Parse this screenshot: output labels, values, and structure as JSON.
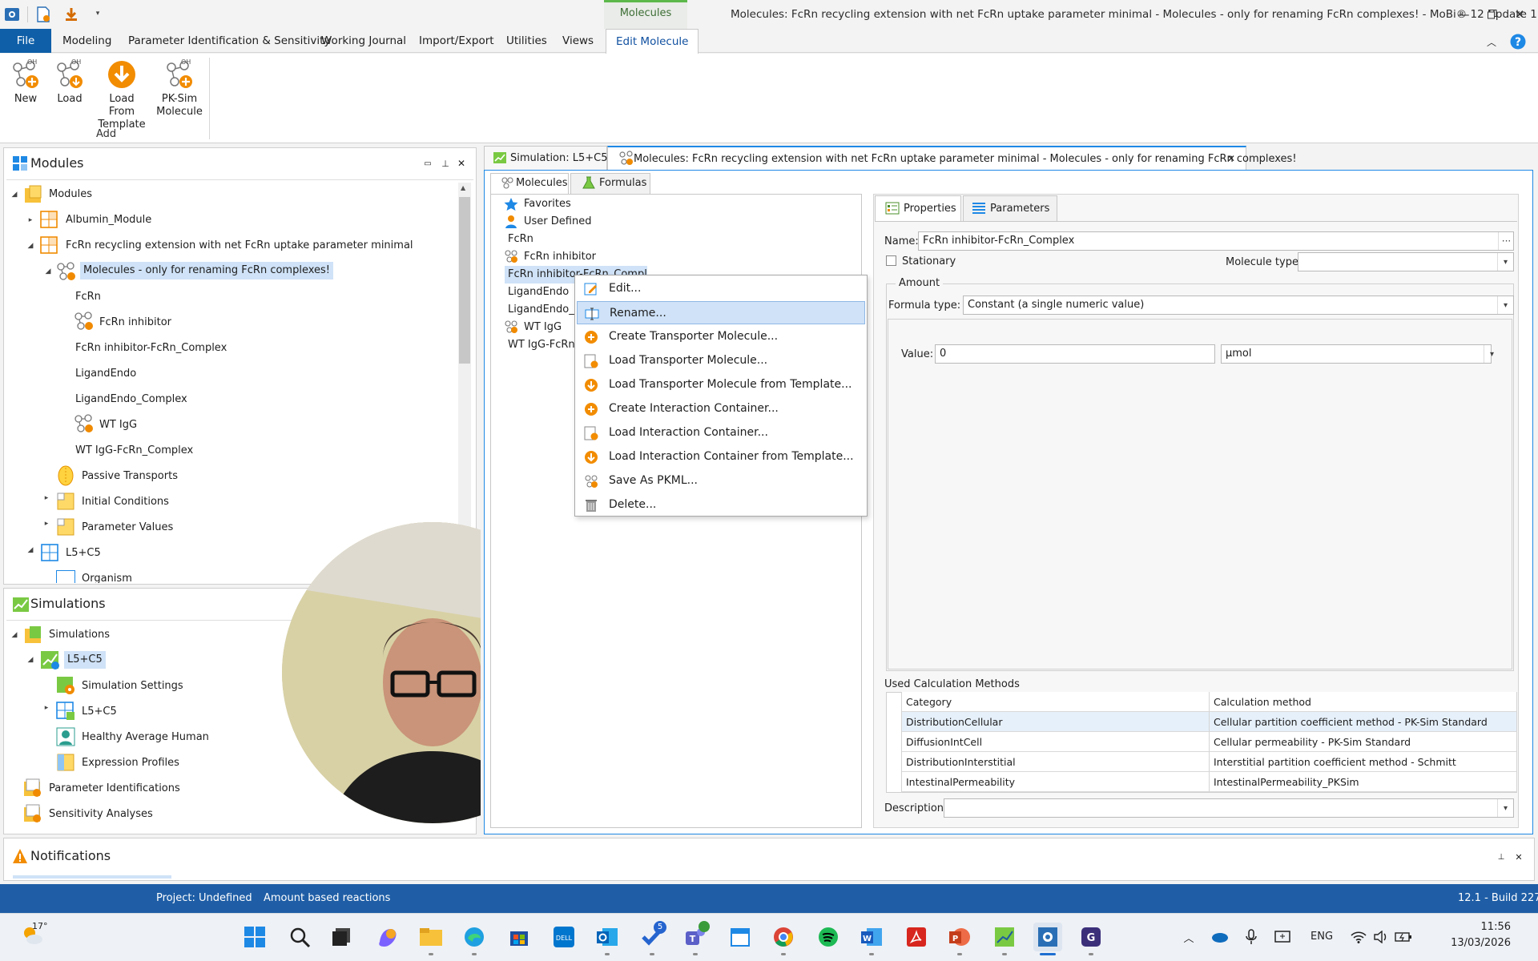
{
  "window": {
    "title": "Molecules: FcRn recycling extension with net FcRn uptake parameter minimal - Molecules - only for renaming FcRn complexes! - MoBi® 12 Update 1",
    "context_tab": "Molecules"
  },
  "menu": {
    "file": "File",
    "modeling": "Modeling",
    "param_ident": "Parameter Identification & Sensitivity",
    "journal": "Working Journal",
    "import_export": "Import/Export",
    "utilities": "Utilities",
    "views": "Views",
    "edit_molecule": "Edit Molecule"
  },
  "ribbon": {
    "new": "New",
    "load": "Load",
    "load_from_template_1": "Load From",
    "load_from_template_2": "Template",
    "pksim_1": "PK-Sim",
    "pksim_2": "Molecule",
    "group": "Add"
  },
  "modules_panel": {
    "title": "Modules",
    "items": [
      "Modules",
      "Albumin_Module",
      "FcRn recycling extension with net FcRn uptake parameter minimal",
      "Molecules - only for renaming FcRn complexes!",
      "FcRn",
      "FcRn inhibitor",
      "FcRn inhibitor-FcRn_Complex",
      "LigandEndo",
      "LigandEndo_Complex",
      "WT IgG",
      "WT IgG-FcRn_Complex",
      "Passive Transports",
      "Initial Conditions",
      "Parameter Values",
      "L5+C5",
      "Organism"
    ]
  },
  "simulations_panel": {
    "title": "Simulations",
    "items": [
      "Simulations",
      "L5+C5",
      "Simulation Settings",
      "L5+C5",
      "Healthy Average Human",
      "Expression Profiles",
      "Parameter Identifications",
      "Sensitivity Analyses"
    ]
  },
  "notifications": {
    "title": "Notifications"
  },
  "doc_tabs": {
    "sim": "Simulation: L5+C5",
    "molecules": "Molecules: FcRn recycling extension with net FcRn uptake parameter minimal - Molecules - only for renaming FcRn complexes!"
  },
  "sub_tabs": {
    "molecules": "Molecules",
    "formulas": "Formulas"
  },
  "molecule_list": [
    "Favorites",
    "User Defined",
    "FcRn",
    "FcRn inhibitor",
    "FcRn inhibitor-FcRn_Complex",
    "LigandEndo",
    "LigandEndo_Co",
    "WT IgG",
    "WT IgG-FcRn_"
  ],
  "context_menu": [
    "Edit...",
    "Rename...",
    "Create Transporter Molecule...",
    "Load Transporter Molecule...",
    "Load Transporter Molecule from Template...",
    "Create Interaction Container...",
    "Load Interaction Container...",
    "Load Interaction Container from Template...",
    "Save As PKML...",
    "Delete..."
  ],
  "properties": {
    "tab_properties": "Properties",
    "tab_parameters": "Parameters",
    "name_label": "Name:",
    "name_value": "FcRn inhibitor-FcRn_Complex",
    "stationary": "Stationary",
    "mol_type_label": "Molecule type:",
    "mol_type_value": "",
    "amount_group": "Amount",
    "formula_type_label": "Formula type:",
    "formula_type_value": "Constant (a single numeric value)",
    "value_label": "Value:",
    "value_value": "0",
    "unit": "µmol",
    "calc_methods_label": "Used Calculation Methods",
    "col_category": "Category",
    "col_method": "Calculation method",
    "rows": [
      [
        "DistributionCellular",
        "Cellular partition coefficient method - PK-Sim Standard"
      ],
      [
        "DiffusionIntCell",
        "Cellular permeability - PK-Sim Standard"
      ],
      [
        "DistributionInterstitial",
        "Interstitial partition coefficient method - Schmitt"
      ],
      [
        "IntestinalPermeability",
        "IntestinalPermeability_PKSim"
      ]
    ],
    "description_label": "Description:"
  },
  "status": {
    "project": "Project: Undefined",
    "mode": "Amount based reactions",
    "build": "12.1 - Build 227"
  },
  "taskbar": {
    "weather": "17°",
    "lang": "ENG",
    "time": "11:56",
    "date": "13/03/2026",
    "badge_todo": "5"
  }
}
